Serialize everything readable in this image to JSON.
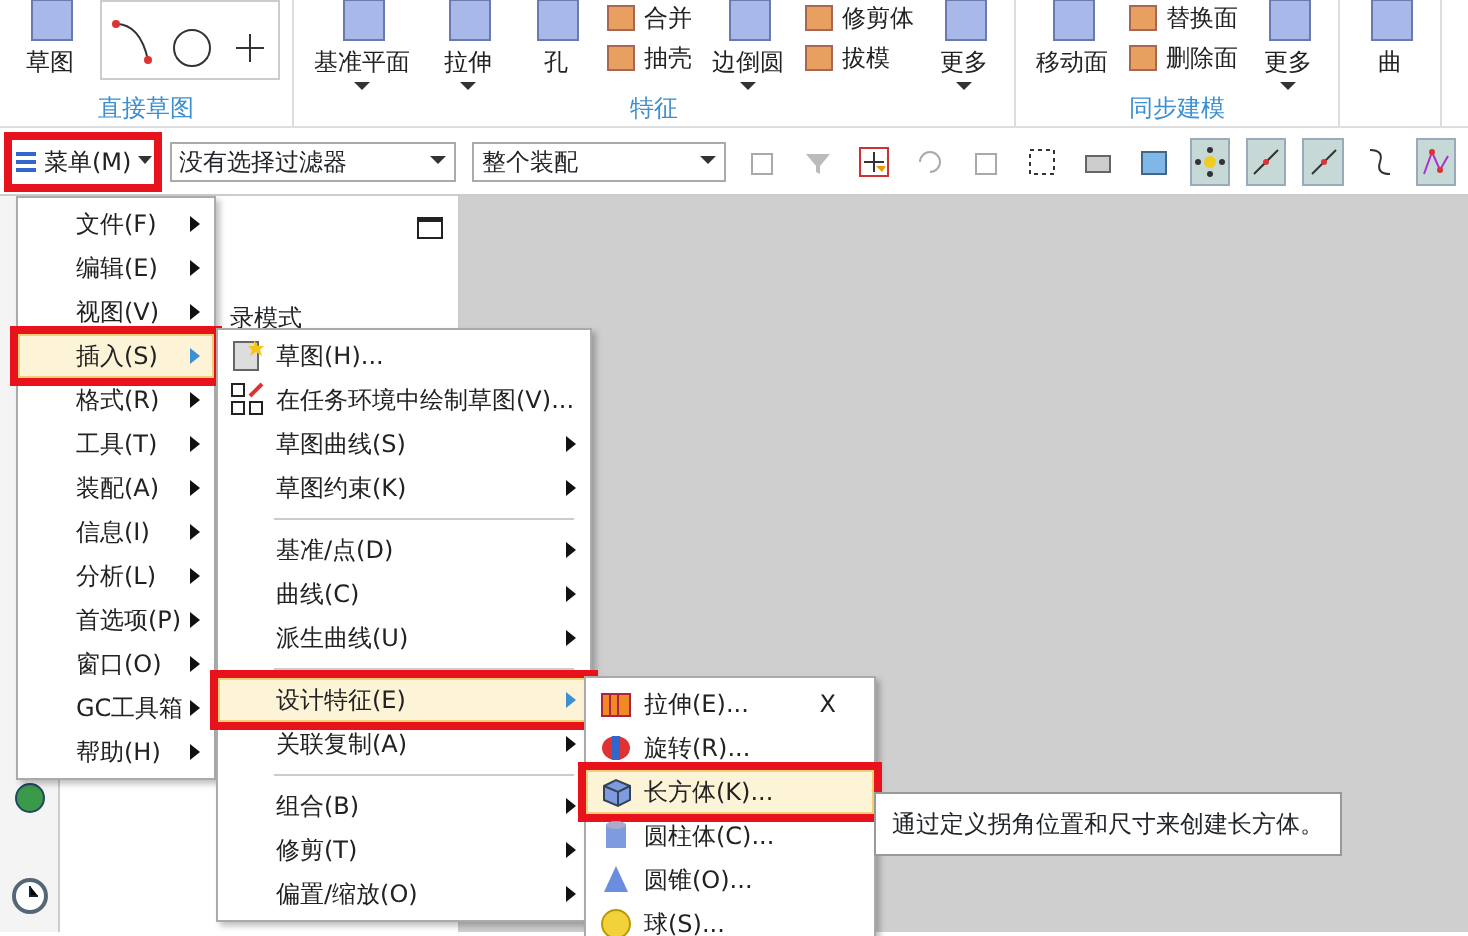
{
  "ribbon": {
    "groups": [
      {
        "label": "直接草图",
        "buttons": [
          {
            "kind": "large",
            "label": "草图",
            "dropdown": false
          },
          {
            "kind": "gallery"
          }
        ]
      },
      {
        "label": "特征",
        "buttons": [
          {
            "kind": "large",
            "label": "基准平面",
            "dropdown": true
          },
          {
            "kind": "large",
            "label": "拉伸",
            "dropdown": true
          },
          {
            "kind": "large",
            "label": "孔",
            "dropdown": false
          },
          {
            "kind": "stack",
            "items": [
              "合并",
              "抽壳"
            ]
          },
          {
            "kind": "large",
            "label": "边倒圆",
            "dropdown": true
          },
          {
            "kind": "stack",
            "items": [
              "修剪体",
              "拔模"
            ]
          },
          {
            "kind": "large",
            "label": "更多",
            "dropdown": true
          }
        ]
      },
      {
        "label": "同步建模",
        "buttons": [
          {
            "kind": "large",
            "label": "移动面",
            "dropdown": false
          },
          {
            "kind": "stack",
            "items": [
              "替换面",
              "删除面"
            ]
          },
          {
            "kind": "large",
            "label": "更多",
            "dropdown": true
          }
        ]
      },
      {
        "buttons": [
          {
            "kind": "large",
            "label": "曲",
            "dropdown": false
          }
        ]
      }
    ]
  },
  "toolbar": {
    "menu_button": {
      "label": "菜单(M)",
      "marked": true
    },
    "dropdowns": [
      {
        "value": "没有选择过滤器"
      },
      {
        "value": "整个装配"
      }
    ],
    "tools": [
      {
        "kind": "part",
        "pressed": false
      },
      {
        "kind": "filter",
        "pressed": false
      },
      {
        "kind": "snap",
        "pressed": false
      },
      {
        "kind": "rotate",
        "pressed": false
      },
      {
        "kind": "part",
        "pressed": false
      },
      {
        "kind": "select-box",
        "pressed": false
      },
      {
        "kind": "printer",
        "pressed": false
      },
      {
        "kind": "cube",
        "pressed": false
      },
      {
        "kind": "points",
        "pressed": true
      },
      {
        "kind": "line",
        "pressed": true
      },
      {
        "kind": "line",
        "pressed": true
      },
      {
        "kind": "curve",
        "pressed": false
      },
      {
        "kind": "graph",
        "pressed": true
      }
    ]
  },
  "navigator": {
    "text": "录模式"
  },
  "main_menu": [
    {
      "label": "文件(F)",
      "selected": false,
      "marked": false
    },
    {
      "label": "编辑(E)",
      "selected": false,
      "marked": false
    },
    {
      "label": "视图(V)",
      "selected": false,
      "marked": false
    },
    {
      "label": "插入(S)",
      "selected": true,
      "marked": true
    },
    {
      "label": "格式(R)",
      "selected": false,
      "marked": false
    },
    {
      "label": "工具(T)",
      "selected": false,
      "marked": false
    },
    {
      "label": "装配(A)",
      "selected": false,
      "marked": false
    },
    {
      "label": "信息(I)",
      "selected": false,
      "marked": false
    },
    {
      "label": "分析(L)",
      "selected": false,
      "marked": false
    },
    {
      "label": "首选项(P)",
      "selected": false,
      "marked": false
    },
    {
      "label": "窗口(O)",
      "selected": false,
      "marked": false
    },
    {
      "label": "GC工具箱",
      "selected": false,
      "marked": false
    },
    {
      "label": "帮助(H)",
      "selected": false,
      "marked": false
    }
  ],
  "insert_menu": [
    {
      "kind": "item",
      "label": "草图(H)...",
      "submenu": false,
      "selected": false,
      "marked": false
    },
    {
      "kind": "item",
      "label": "在任务环境中绘制草图(V)...",
      "submenu": false,
      "selected": false,
      "marked": false
    },
    {
      "kind": "item",
      "label": "草图曲线(S)",
      "submenu": true,
      "selected": false,
      "marked": false
    },
    {
      "kind": "item",
      "label": "草图约束(K)",
      "submenu": true,
      "selected": false,
      "marked": false
    },
    {
      "kind": "separator"
    },
    {
      "kind": "item",
      "label": "基准/点(D)",
      "submenu": true,
      "selected": false,
      "marked": false
    },
    {
      "kind": "item",
      "label": "曲线(C)",
      "submenu": true,
      "selected": false,
      "marked": false
    },
    {
      "kind": "item",
      "label": "派生曲线(U)",
      "submenu": true,
      "selected": false,
      "marked": false
    },
    {
      "kind": "separator"
    },
    {
      "kind": "item",
      "label": "设计特征(E)",
      "submenu": true,
      "selected": true,
      "marked": true
    },
    {
      "kind": "item",
      "label": "关联复制(A)",
      "submenu": true,
      "selected": false,
      "marked": false
    },
    {
      "kind": "separator"
    },
    {
      "kind": "item",
      "label": "组合(B)",
      "submenu": true,
      "selected": false,
      "marked": false
    },
    {
      "kind": "item",
      "label": "修剪(T)",
      "submenu": true,
      "selected": false,
      "marked": false
    },
    {
      "kind": "item",
      "label": "偏置/缩放(O)",
      "submenu": true,
      "selected": false,
      "marked": false
    }
  ],
  "design_menu": [
    {
      "label": "拉伸(E)...",
      "shortcut": "X",
      "selected": false,
      "marked": false
    },
    {
      "label": "旋转(R)...",
      "selected": false,
      "marked": false
    },
    {
      "label": "长方体(K)...",
      "selected": true,
      "marked": true
    },
    {
      "label": "圆柱体(C)...",
      "selected": false,
      "marked": false
    },
    {
      "label": "圆锥(O)...",
      "selected": false,
      "marked": false
    },
    {
      "label": "球(S)...",
      "selected": false,
      "marked": false
    }
  ],
  "tooltip": "通过定义拐角位置和尺寸来创建长方体。"
}
